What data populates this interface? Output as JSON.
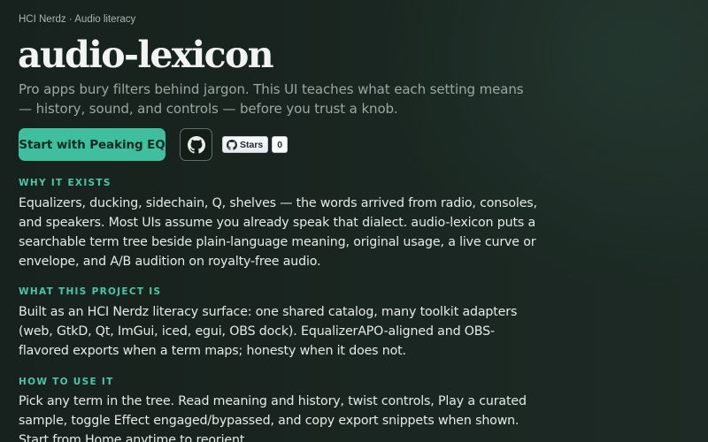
{
  "header": {
    "breadcrumb": "HCI Nerdz · Audio literacy",
    "title": "audio-lexicon",
    "subtitle": "Pro apps bury filters behind jargon. This UI teaches what each setting means — history, sound, and controls — before you trust a knob."
  },
  "actions": {
    "primary_label": "Start with Peaking EQ",
    "github_icon": "github-icon",
    "stars_label": "Stars",
    "stars_count": "0"
  },
  "sections": [
    {
      "heading": "WHY IT EXISTS",
      "body": "Equalizers, ducking, sidechain, Q, shelves — the words arrived from radio, consoles, and speakers. Most UIs assume you already speak that dialect. audio-lexicon puts a searchable term tree beside plain-language meaning, original usage, a live curve or envelope, and A/B audition on royalty-free audio."
    },
    {
      "heading": "WHAT THIS PROJECT IS",
      "body": "Built as an HCI Nerdz literacy surface: one shared catalog, many toolkit adapters (web, GtkD, Qt, ImGui, iced, egui, OBS dock). EqualizerAPO-aligned and OBS-flavored exports when a term maps; honesty when it does not."
    },
    {
      "heading": "HOW TO USE IT",
      "body": "Pick any term in the tree. Read meaning and history, twist controls, Play a curated sample, toggle Effect engaged/bypassed, and copy export snippets when shown. Start from Home anytime to reorient."
    }
  ],
  "colors": {
    "accent": "#3fbf9d",
    "section_heading": "#4cc6a4",
    "background": "#1a2621"
  }
}
